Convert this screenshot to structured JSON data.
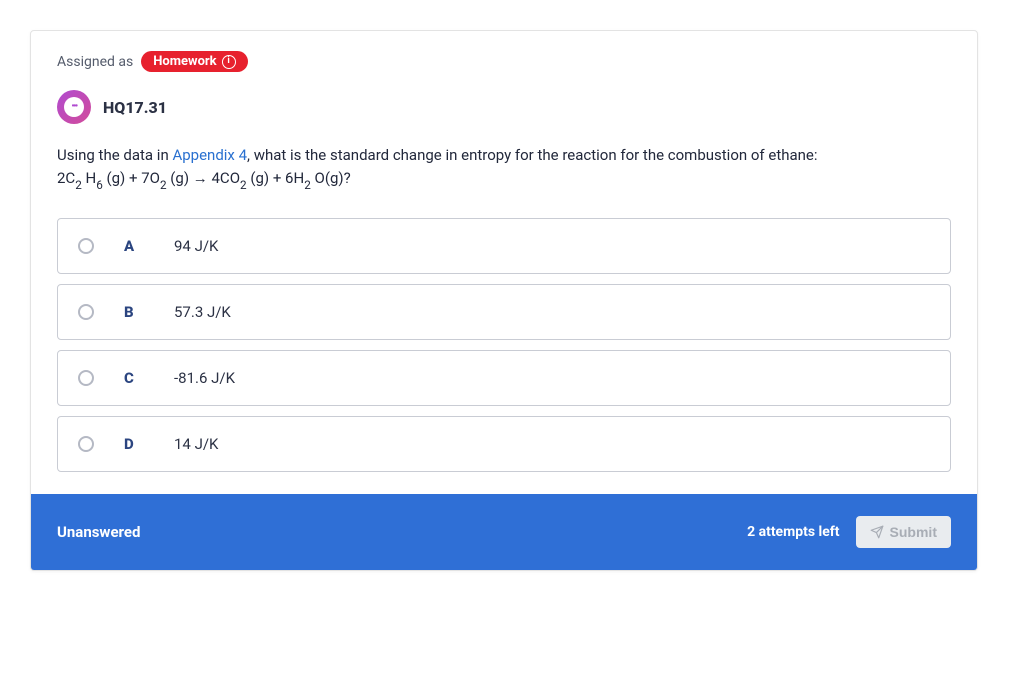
{
  "header": {
    "assigned_label": "Assigned as",
    "pill_text": "Homework",
    "question_number": "HQ17.31",
    "icon_dots": "•••"
  },
  "prompt": {
    "pre": "Using the data in ",
    "link_text": "Appendix 4",
    "post": ", what is the standard change in entropy for the reaction for the combustion of ethane:",
    "equation_parts": {
      "p1": "2C",
      "s1": "2",
      "p2": " H",
      "s2": "6",
      "p3": " (g) + 7O",
      "s3": "2",
      "p4": " (g) → 4CO",
      "s4": "2",
      "p5": " (g) + 6H",
      "s5": "2",
      "p6": " O(g)?"
    }
  },
  "options": [
    {
      "letter": "A",
      "text": "94 J/K"
    },
    {
      "letter": "B",
      "text": "57.3 J/K"
    },
    {
      "letter": "C",
      "text": "-81.6 J/K"
    },
    {
      "letter": "D",
      "text": "14 J/K"
    }
  ],
  "footer": {
    "status": "Unanswered",
    "attempts": "2 attempts left",
    "submit_label": "Submit"
  }
}
